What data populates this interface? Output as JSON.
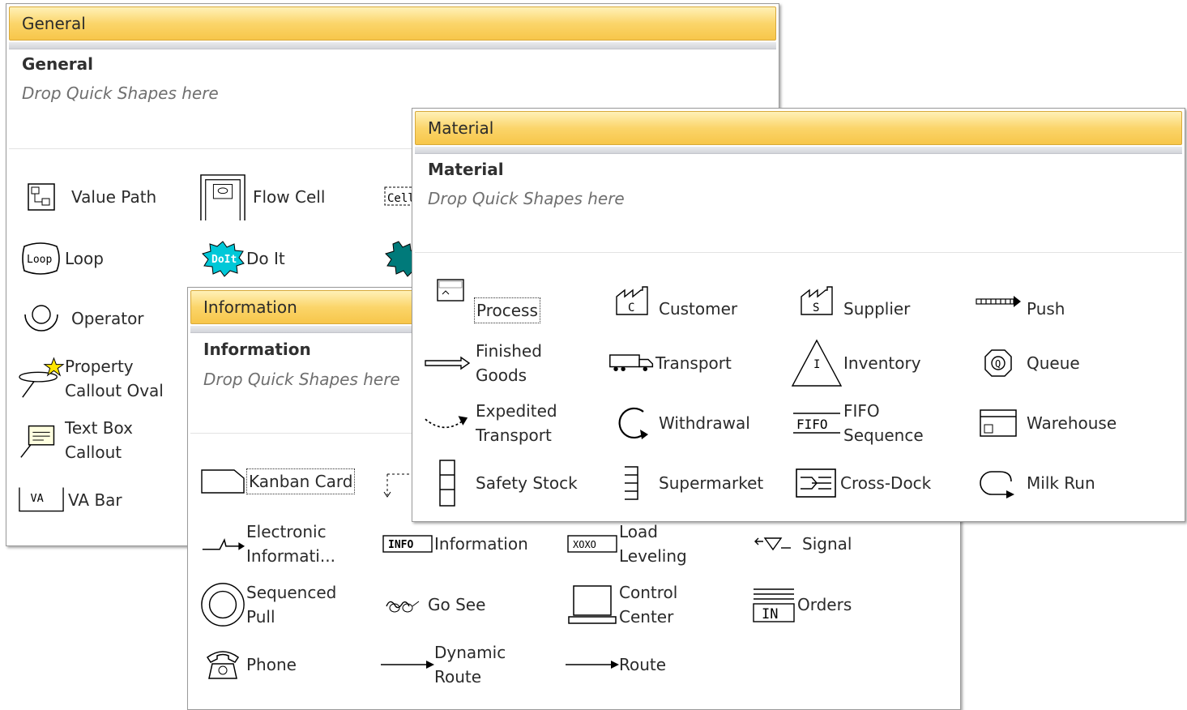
{
  "general": {
    "title": "General",
    "heading": "General",
    "drop_text": "Drop Quick Shapes here",
    "shapes": [
      {
        "label": "Value Path",
        "icon": "value-path-icon"
      },
      {
        "label": "Flow Cell",
        "icon": "flow-cell-icon"
      },
      {
        "label": "Loop",
        "icon": "loop-icon"
      },
      {
        "label": "Do It",
        "icon": "do-it-icon"
      },
      {
        "label": "Operator",
        "icon": "operator-icon"
      },
      {
        "label": "Property Callout Oval",
        "icon": "property-callout-oval-icon"
      },
      {
        "label": "Text Box Callout",
        "icon": "text-box-callout-icon"
      },
      {
        "label": "VA Bar",
        "icon": "va-bar-icon"
      }
    ],
    "partial_icon_text": "Cell"
  },
  "information": {
    "title": "Information",
    "heading": "Information",
    "drop_text": "Drop Quick Shapes here",
    "shapes": [
      {
        "label": "Kanban Card",
        "icon": "kanban-card-icon"
      },
      {
        "label": "Electronic Informati...",
        "icon": "electronic-information-icon"
      },
      {
        "label": "Information",
        "icon": "information-icon"
      },
      {
        "label": "Load Leveling",
        "icon": "load-leveling-icon"
      },
      {
        "label": "Signal",
        "icon": "signal-icon"
      },
      {
        "label": "Sequenced Pull",
        "icon": "sequenced-pull-icon"
      },
      {
        "label": "Go See",
        "icon": "go-see-icon"
      },
      {
        "label": "Control Center",
        "icon": "control-center-icon"
      },
      {
        "label": "Orders",
        "icon": "orders-icon"
      },
      {
        "label": "Phone",
        "icon": "phone-icon"
      },
      {
        "label": "Dynamic Route",
        "icon": "dynamic-route-icon"
      },
      {
        "label": "Route",
        "icon": "route-icon"
      }
    ]
  },
  "material": {
    "title": "Material",
    "heading": "Material",
    "drop_text": "Drop Quick Shapes here",
    "shapes": [
      {
        "label": "Process",
        "icon": "process-icon"
      },
      {
        "label": "Customer",
        "icon": "customer-icon"
      },
      {
        "label": "Supplier",
        "icon": "supplier-icon"
      },
      {
        "label": "Push",
        "icon": "push-arrow-icon"
      },
      {
        "label": "Finished Goods",
        "icon": "finished-goods-icon"
      },
      {
        "label": "Transport",
        "icon": "transport-truck-icon"
      },
      {
        "label": "Inventory",
        "icon": "inventory-icon"
      },
      {
        "label": "Queue",
        "icon": "queue-icon"
      },
      {
        "label": "Expedited Transport",
        "icon": "expedited-transport-icon"
      },
      {
        "label": "Withdrawal",
        "icon": "withdrawal-icon"
      },
      {
        "label": "FIFO Sequence",
        "icon": "fifo-sequence-icon"
      },
      {
        "label": "Warehouse",
        "icon": "warehouse-icon"
      },
      {
        "label": "Safety Stock",
        "icon": "safety-stock-icon"
      },
      {
        "label": "Supermarket",
        "icon": "supermarket-icon"
      },
      {
        "label": "Cross-Dock",
        "icon": "cross-dock-icon"
      },
      {
        "label": "Milk Run",
        "icon": "milk-run-icon"
      }
    ]
  },
  "icon_text": {
    "loop": "Loop",
    "do_it": "DoIt",
    "va": "VA",
    "info": "INFO",
    "xoxo": "XOXO",
    "in": "IN",
    "fifo": "FIFO",
    "customer_c": "C",
    "supplier_s": "S",
    "inventory_i": "I",
    "queue_q": "Q"
  },
  "colors": {
    "title_bar": "#fbd56a",
    "do_it_fill": "#00c8d8",
    "dark_teal_fill": "#007a7a"
  }
}
